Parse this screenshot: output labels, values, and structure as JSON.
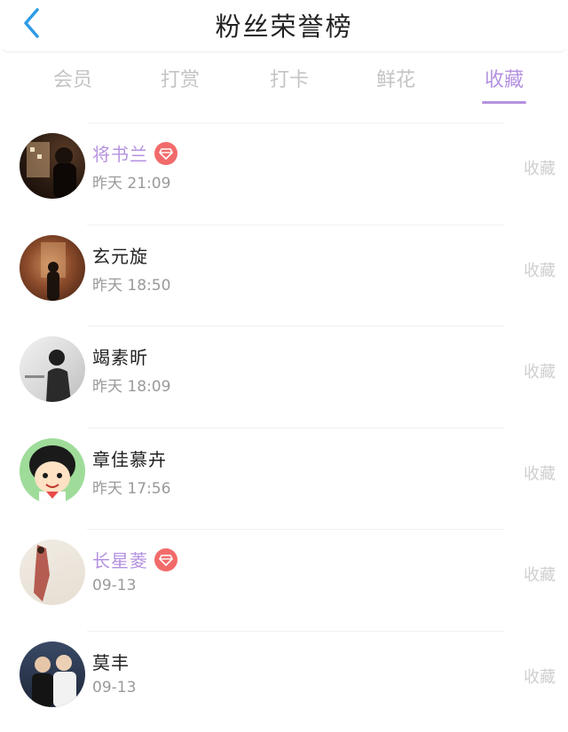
{
  "header": {
    "title": "粉丝荣誉榜"
  },
  "tabs": [
    {
      "label": "会员"
    },
    {
      "label": "打赏"
    },
    {
      "label": "打卡"
    },
    {
      "label": "鲜花"
    },
    {
      "label": "收藏"
    }
  ],
  "active_tab": "收藏",
  "accent_color": "#b592e0",
  "badge_color": "#f26b6b",
  "rows": [
    {
      "name": "将书兰",
      "time": "昨天 21:09",
      "vip": true,
      "action": "收藏"
    },
    {
      "name": "玄元旋",
      "time": "昨天 18:50",
      "vip": false,
      "action": "收藏"
    },
    {
      "name": "竭素昕",
      "time": "昨天 18:09",
      "vip": false,
      "action": "收藏"
    },
    {
      "name": "章佳慕卉",
      "time": "昨天 17:56",
      "vip": false,
      "action": "收藏"
    },
    {
      "name": "长星菱",
      "time": "09-13",
      "vip": true,
      "action": "收藏"
    },
    {
      "name": "莫丰",
      "time": "09-13",
      "vip": false,
      "action": "收藏"
    }
  ]
}
